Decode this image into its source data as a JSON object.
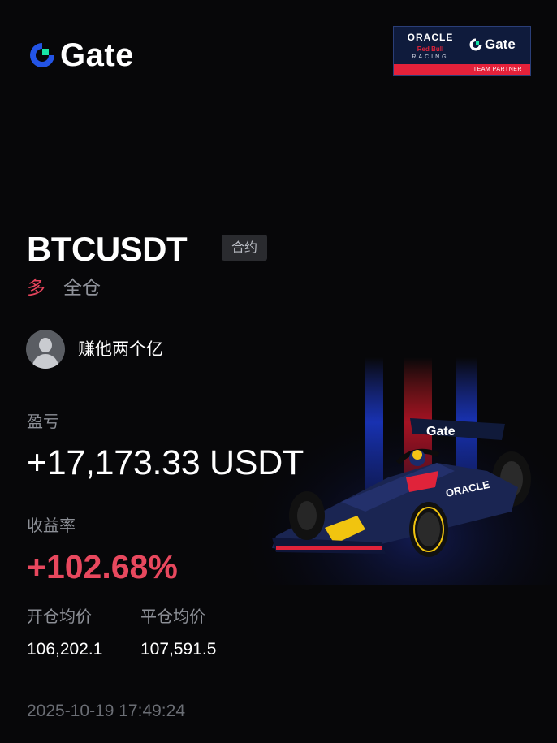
{
  "brand": {
    "name": "Gate",
    "logo_icon": "gate-logo-icon",
    "accent": "#2354e6",
    "accent2": "#17e5a6"
  },
  "partner_badge": {
    "oracle": "ORACLE",
    "redbull": "Red Bull",
    "racing": "RACING",
    "gate": "Gate",
    "strip": "TEAM PARTNER"
  },
  "position": {
    "symbol": "BTCUSDT",
    "type_tag": "合约",
    "side": "多",
    "margin_mode": "全仓"
  },
  "user": {
    "name": "赚他两个亿",
    "avatar_icon": "user-avatar-icon"
  },
  "pnl": {
    "label": "盈亏",
    "value": "+17,173.33 USDT"
  },
  "roi": {
    "label": "收益率",
    "value": "+102.68%"
  },
  "prices": {
    "open_label": "开仓均价",
    "open_value": "106,202.1",
    "close_label": "平仓均价",
    "close_value": "107,591.5"
  },
  "timestamp": "2025-10-19 17:49:24",
  "colors": {
    "profit": "#e8485e",
    "muted": "#8c8f96",
    "background": "#070709"
  }
}
